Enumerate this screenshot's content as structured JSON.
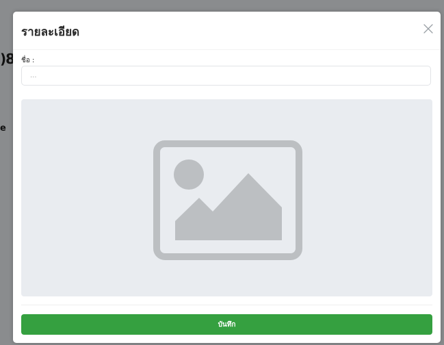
{
  "background": {
    "partial_text_1": ")8",
    "partial_text_2": "e"
  },
  "modal": {
    "title": "รายละเอียด",
    "close_icon": "close-icon",
    "name_label": "ชื่อ :",
    "name_input_placeholder": "...",
    "name_input_value": "",
    "image_placeholder_icon": "image-placeholder-icon",
    "save_label": "บันทึก"
  },
  "colors": {
    "accent": "#35a040",
    "image_bg": "#e9ecf0",
    "icon_gray": "#bcbfc2",
    "overlay": "#7d7f81"
  }
}
